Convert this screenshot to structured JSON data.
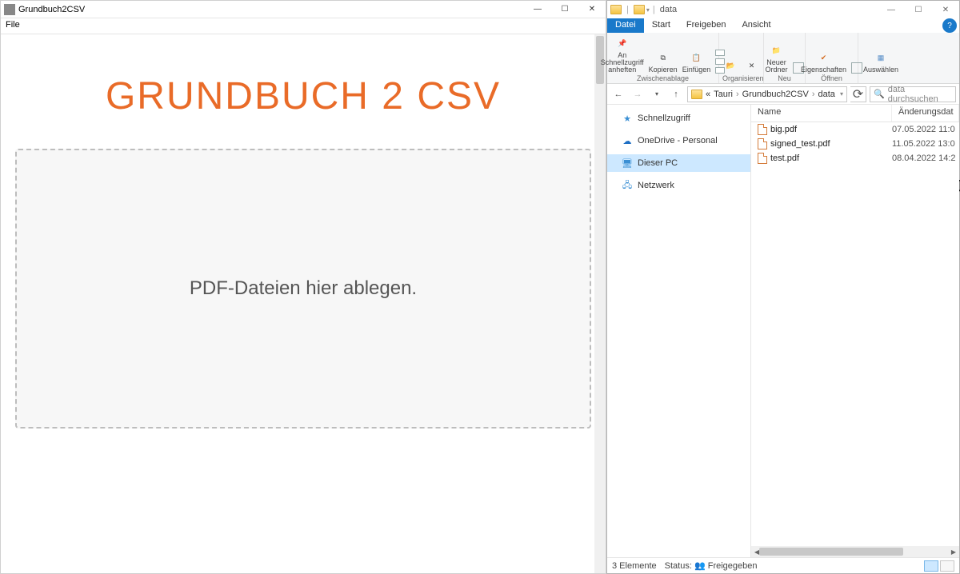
{
  "app": {
    "title": "Grundbuch2CSV",
    "menu": {
      "file": "File"
    },
    "heading": "GRUNDBUCH 2 CSV",
    "dropzone": "PDF-Dateien hier ablegen."
  },
  "explorer": {
    "title": "data",
    "tabs": [
      "Datei",
      "Start",
      "Freigeben",
      "Ansicht"
    ],
    "ribbon": {
      "pin": "An Schnellzugriff anheften",
      "copy": "Kopieren",
      "paste": "Einfügen",
      "group_clipboard": "Zwischenablage",
      "group_organize": "Organisieren",
      "new_folder": "Neuer Ordner",
      "group_new": "Neu",
      "properties": "Eigenschaften",
      "group_open": "Öffnen",
      "select": "Auswählen",
      "delete": "✕"
    },
    "breadcrumb": [
      "«",
      "Tauri",
      "Grundbuch2CSV",
      "data"
    ],
    "search_placeholder": "data durchsuchen",
    "nav": {
      "quick": "Schnellzugriff",
      "onedrive": "OneDrive - Personal",
      "thispc": "Dieser PC",
      "network": "Netzwerk"
    },
    "columns": {
      "name": "Name",
      "date": "Änderungsdat"
    },
    "files": [
      {
        "name": "big.pdf",
        "date": "07.05.2022 11:0"
      },
      {
        "name": "signed_test.pdf",
        "date": "11.05.2022 13:0"
      },
      {
        "name": "test.pdf",
        "date": "08.04.2022 14:2"
      }
    ],
    "status": {
      "count": "3 Elemente",
      "state_label": "Status:",
      "state": "Freigegeben"
    }
  }
}
